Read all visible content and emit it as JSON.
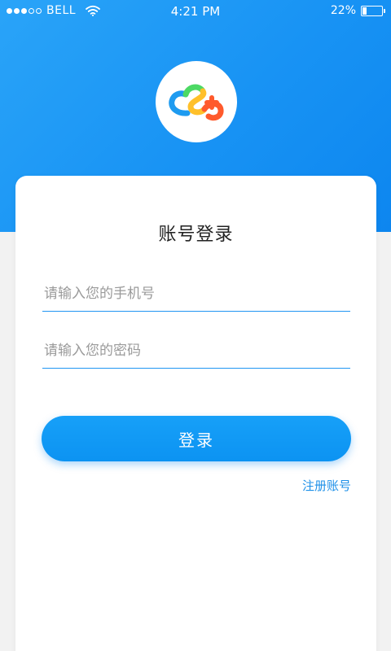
{
  "status_bar": {
    "carrier": "BELL",
    "time": "4:21 PM",
    "battery": "22%",
    "signal_bars_filled": 3,
    "signal_bars_total": 5,
    "battery_level": 0.22
  },
  "theme": {
    "primary": "#1893f4",
    "hero_gradient": [
      "#2aa4f8",
      "#0d86ef"
    ],
    "page_bg": "#f2f2f2",
    "logo_colors": [
      "#ff5a2c",
      "#ffc02a",
      "#4cd964",
      "#1e9bf0"
    ]
  },
  "logo": {
    "icon": "cloud-logo-icon"
  },
  "login": {
    "title": "账号登录",
    "phone_placeholder": "请输入您的手机号",
    "phone_value": "",
    "password_placeholder": "请输入您的密码",
    "password_value": "",
    "submit_label": "登录",
    "register_label": "注册账号"
  }
}
